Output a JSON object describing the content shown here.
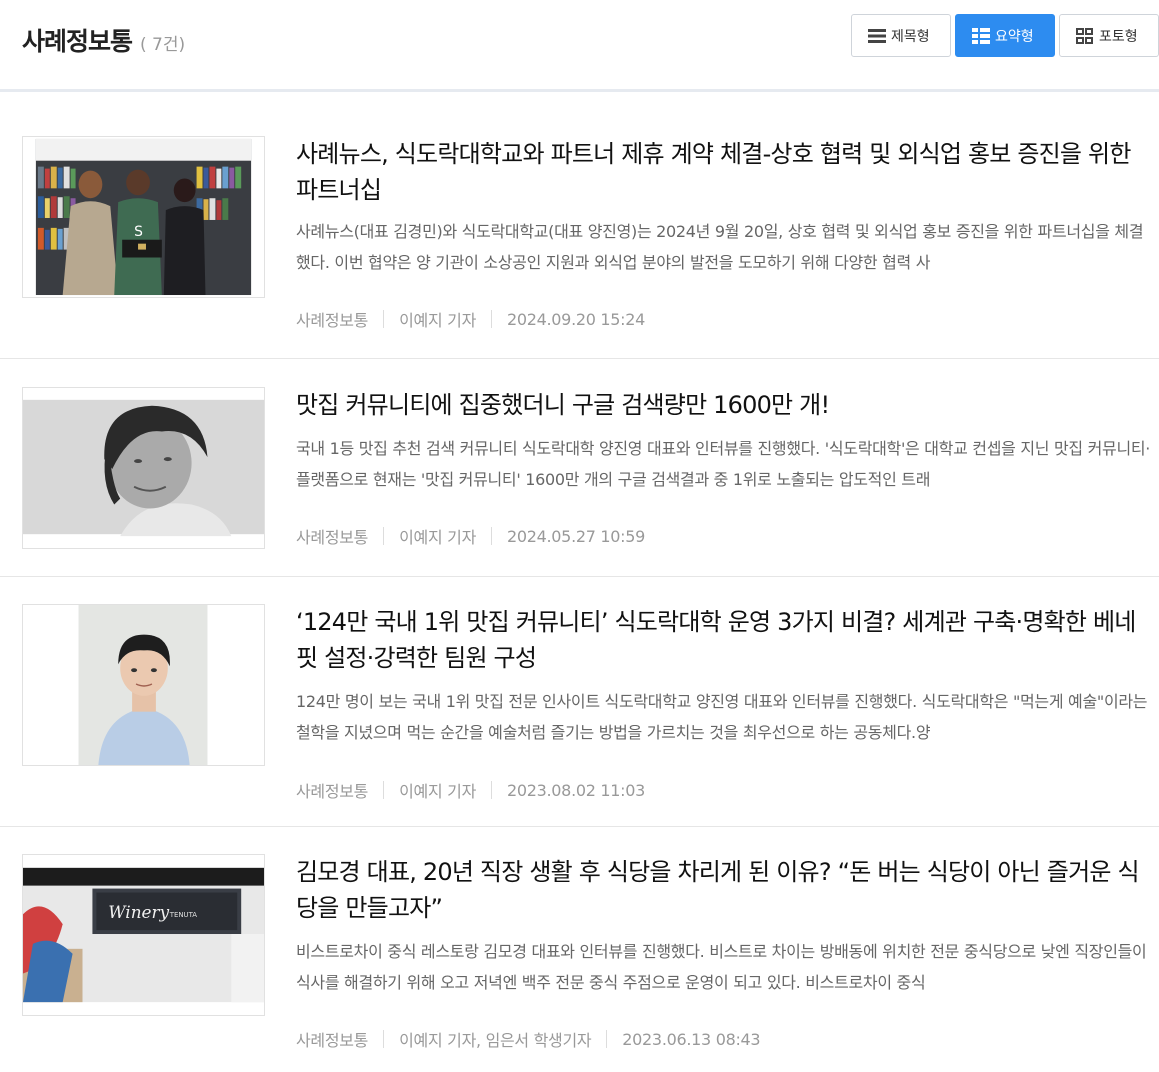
{
  "header": {
    "title": "사례정보통",
    "count": "( 7건)"
  },
  "view_toggle": {
    "title_label": "제목형",
    "summary_label": "요약형",
    "photo_label": "포토형",
    "active": "summary"
  },
  "colors": {
    "accent": "#2d8cf0",
    "meta_text": "#999999",
    "summary_text": "#666666"
  },
  "articles": [
    {
      "title": "사례뉴스, 식도락대학교와 파트너 제휴 계약 체결-상호 협력 및 외식업 홍보 증진을 위한 파트너십",
      "summary": "사례뉴스(대표 김경민)와 식도락대학교(대표 양진영)는 2024년 9월 20일, 상호 협력 및 외식업 홍보 증진을 위한 파트너십을 체결했다. 이번 협약은 양 기관이 소상공인 지원과 외식업 분야의 발전을 도모하기 위해 다양한 협력 사",
      "section": "사례정보통",
      "author": "이예지 기자",
      "date": "2024.09.20 15:24"
    },
    {
      "title": "맛집 커뮤니티에 집중했더니 구글 검색량만 1600만 개!",
      "summary": "국내 1등 맛집 추천 검색 커뮤니티 식도락대학 양진영 대표와 인터뷰를 진행했다. '식도락대학'은 대학교 컨셉을 지닌 맛집 커뮤니티·플랫폼으로 현재는 '맛집 커뮤니티' 1600만 개의 구글 검색결과 중 1위로 노출되는 압도적인 트래",
      "section": "사례정보통",
      "author": "이예지 기자",
      "date": "2024.05.27 10:59"
    },
    {
      "title": "‘124만 국내 1위 맛집 커뮤니티’ 식도락대학 운영 3가지 비결? 세계관 구축·명확한 베네핏 설정·강력한 팀원 구성",
      "summary": "124만 명이 보는 국내 1위 맛집 전문 인사이트 식도락대학교 양진영 대표와 인터뷰를 진행했다. 식도락대학은 \"먹는게 예술\"이라는 철학을 지녔으며 먹는 순간을 예술처럼 즐기는 방법을 가르치는 것을 최우선으로 하는 공동체다.양",
      "section": "사례정보통",
      "author": "이예지 기자",
      "date": "2023.08.02 11:03"
    },
    {
      "title": "김모경 대표, 20년 직장 생활 후 식당을 차리게 된 이유? “돈 버는 식당이 아닌 즐거운 식당을 만들고자”",
      "summary": "비스트로차이 중식 레스토랑 김모경 대표와 인터뷰를 진행했다. 비스트로 차이는 방배동에 위치한 전문 중식당으로 낮엔 직장인들이 식사를 해결하기 위해 오고 저녁엔 백주 전문 중식 주점으로 운영이 되고 있다. 비스트로차이 중식",
      "section": "사례정보통",
      "author": "이예지 기자, 임은서 학생기자",
      "date": "2023.06.13 08:43",
      "sign_text": "Winery",
      "sign_subtext": "TENUTA"
    }
  ]
}
